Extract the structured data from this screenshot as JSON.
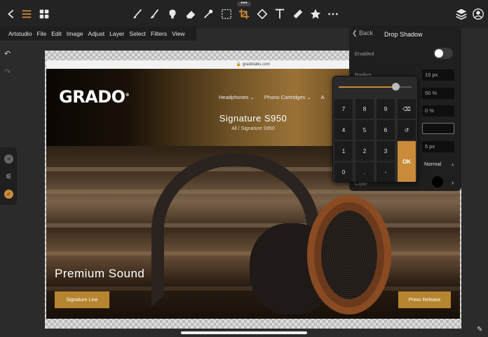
{
  "menubar": {
    "items": [
      "Artstudio",
      "File",
      "Edit",
      "Image",
      "Adjust",
      "Layer",
      "Select",
      "Filters",
      "View"
    ]
  },
  "toolbar": {
    "left_icons": [
      "close-icon",
      "menu-icon",
      "grid-icon"
    ],
    "tools": [
      "brush-icon",
      "smudge-icon",
      "stamp-icon",
      "eraser-icon",
      "eyedropper-icon",
      "selection-icon",
      "crop-icon",
      "fill-icon",
      "text-icon",
      "ruler-icon",
      "star-icon",
      "more-icon"
    ],
    "right_icons": [
      "layers-icon",
      "profile-icon"
    ],
    "active_tool": "crop",
    "accent": "#d08a35"
  },
  "website": {
    "url": "gradolabs.com",
    "logo": "GRADO",
    "nav": [
      "Headphones ⌄",
      "Phono Cartridges ⌄",
      "A"
    ],
    "product_title": "Signature S950",
    "product_sub": "All / Signature S950",
    "hero_text": "Premium Sound",
    "button_left": "Signature Line",
    "button_right": "Press Release",
    "button_color": "#b5852f"
  },
  "panel": {
    "back_label": "Back",
    "title": "Drop Shadow",
    "enabled_label": "Enabled",
    "radius_label": "Radius",
    "radius_value": "15 px",
    "opacity_value": "50 %",
    "angle_value": "0 %",
    "distance_value": "",
    "spread_value": "5 px",
    "blend_value": "Normal",
    "color_label": "Color"
  },
  "numpad": {
    "keys": [
      "7",
      "8",
      "9",
      "⌫",
      "4",
      "5",
      "6",
      "↺",
      "1",
      "2",
      "3",
      "0",
      ".",
      "-"
    ],
    "ok_label": "OK",
    "slider_value": 0.78
  }
}
